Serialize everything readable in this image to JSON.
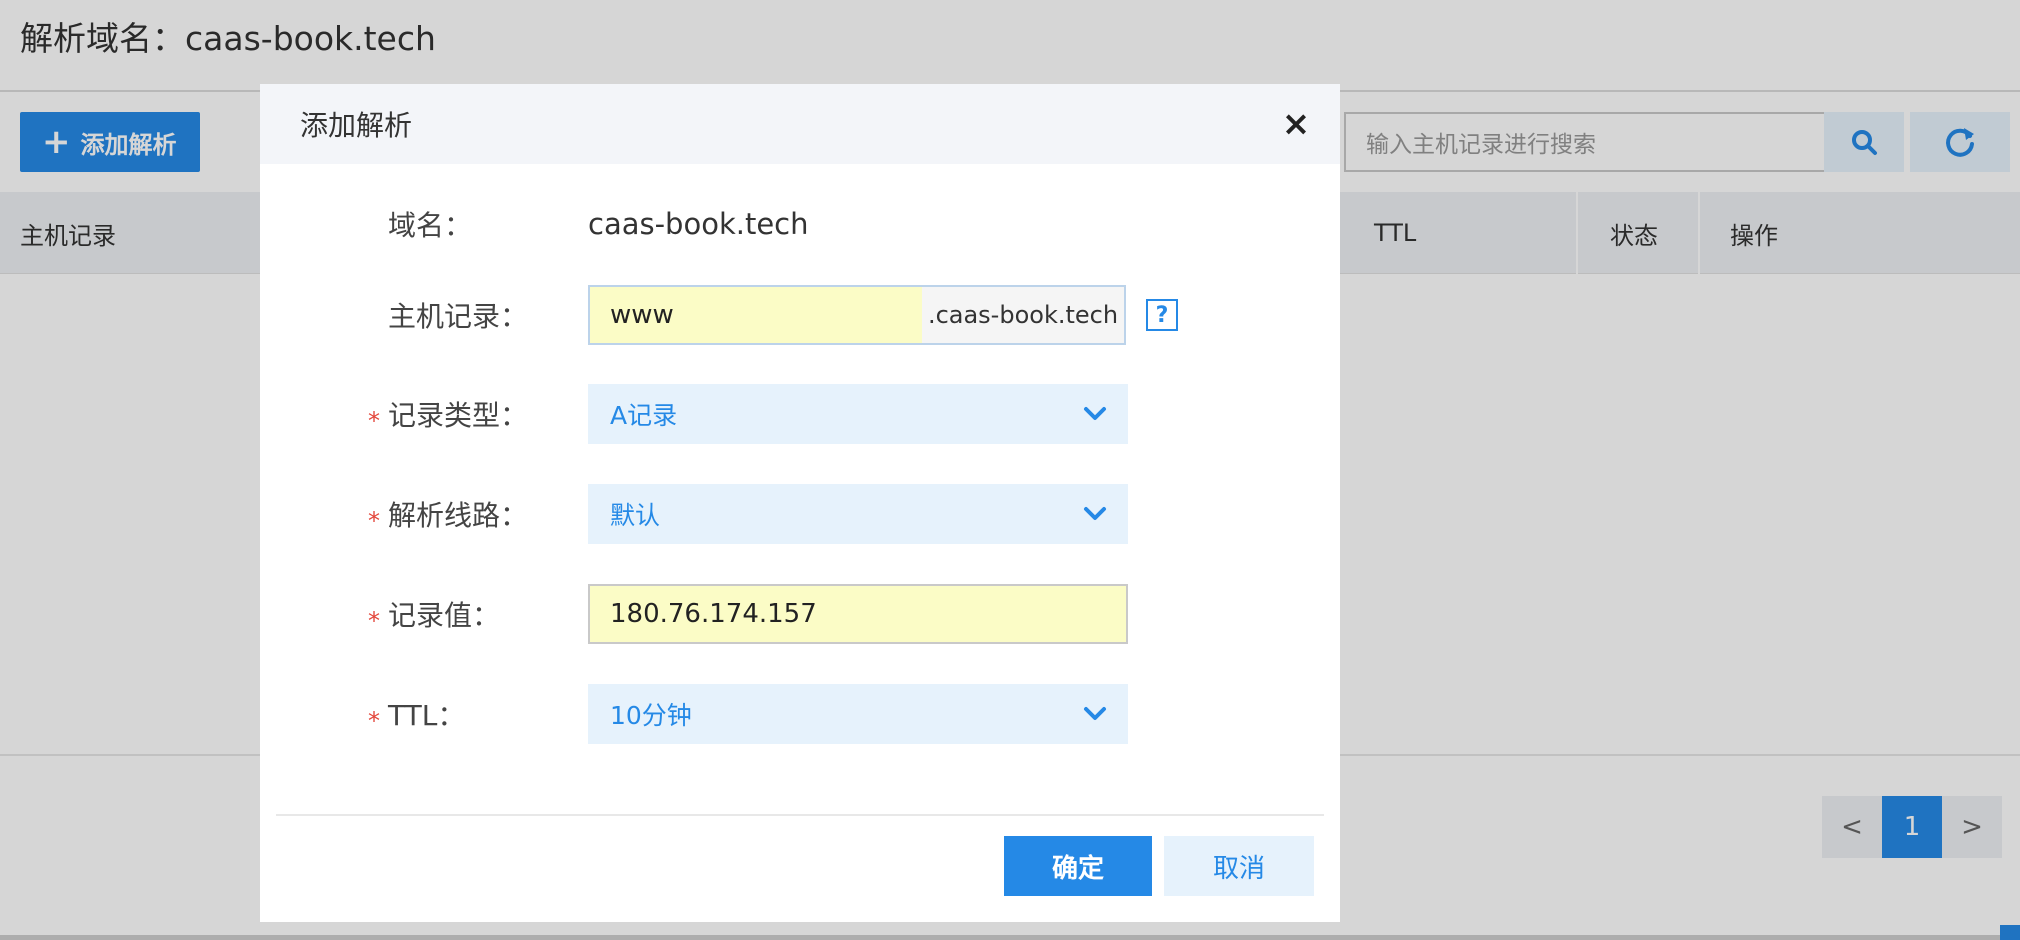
{
  "page": {
    "title": "解析域名：caas-book.tech",
    "add_button": "添加解析",
    "search_placeholder": "输入主机记录进行搜索",
    "table_headers": [
      "主机记录",
      "TTL",
      "状态",
      "操作"
    ],
    "pagination": {
      "prev": "<",
      "current": "1",
      "next": ">"
    }
  },
  "modal": {
    "title": "添加解析",
    "close": "×",
    "fields": {
      "domain": {
        "label": "域名：",
        "value": "caas-book.tech"
      },
      "host_record": {
        "label": "主机记录：",
        "value": "www",
        "suffix": ".caas-book.tech",
        "help": "?"
      },
      "record_type": {
        "label": "记录类型：",
        "value": "A记录",
        "required": "*"
      },
      "line": {
        "label": "解析线路：",
        "value": "默认",
        "required": "*"
      },
      "record_value": {
        "label": "记录值：",
        "value": "180.76.174.157",
        "required": "*"
      },
      "ttl": {
        "label": "TTL：",
        "value": "10分钟",
        "required": "*"
      }
    },
    "confirm": "确定",
    "cancel": "取消"
  },
  "colors": {
    "accent": "#2589e6",
    "required": "#e3463b",
    "input_highlight": "#fbfcc6",
    "select_bg": "#e6f2fc"
  },
  "icons": [
    "plus-icon",
    "search-icon",
    "refresh-icon",
    "close-icon",
    "help-icon",
    "chevron-down-icon"
  ]
}
